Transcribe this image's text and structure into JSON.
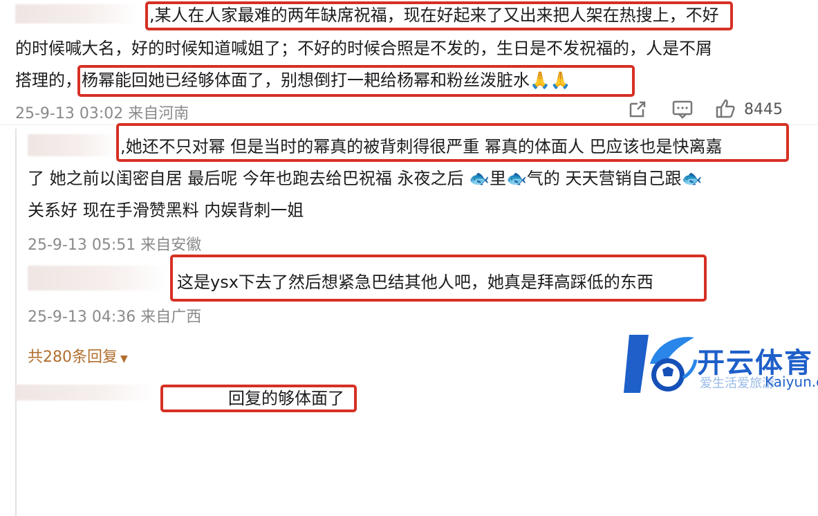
{
  "comments": [
    {
      "lines": [
        ",某人在人家最难的两年缺席祝福，现在好起来了又出来把人架在热搜上，不好",
        "的时候喊大名，好的时候知道喊姐了；不好的时候合照是不发的，生日是不发祝福的，人是不屑",
        "搭理的，杨幂能回她已经够体面了，别想倒打一耙给杨幂和粉丝泼脏水"
      ],
      "emoji": "🙏🙏",
      "meta": "25-9-13 03:02 来自河南",
      "like_count": "8445"
    },
    {
      "lines": [
        ",她还不只对幂 但是当时的幂真的被背刺得很严重 幂真的体面人 巴应该也是快离嘉",
        "了 她之前以闺密自居 最后呢 今年也跑去给巴祝福 永夜之后 🐟里🐟气的 天天营销自己跟🐟",
        "关系好 现在手滑赞黑料 内娱背刺一姐"
      ],
      "meta": "25-9-13 05:51 来自安徽"
    },
    {
      "lines": [
        "这是ysx下去了然后想紧急巴结其他人吧，她真是拜高踩低的东西"
      ],
      "meta": "25-9-13 04:36 来自广西"
    }
  ],
  "replies_toggle": "共280条回复",
  "bottom_comment": "回复的够体面了",
  "watermark": {
    "brand": "开云体育",
    "sub": "爱生活爱旅游",
    "domain": "Kaiyun.com"
  },
  "colors": {
    "highlight": "#d63024",
    "meta": "#8a8a8a",
    "reply": "#b06e2e",
    "brand": "#2a6fd6"
  }
}
